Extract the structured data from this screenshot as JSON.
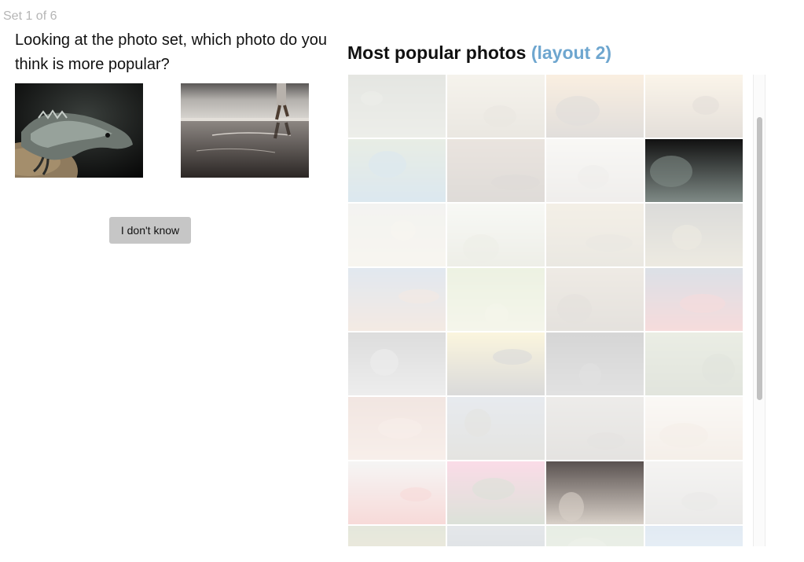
{
  "progress": {
    "label": "Set 1 of 6"
  },
  "question": {
    "text": "Looking at the photo set, which photo do you think is more popular?"
  },
  "choices": [
    {
      "subject": "iguana-photo"
    },
    {
      "subject": "beach-walker-photo"
    }
  ],
  "dont_know": {
    "label": "I don't know"
  },
  "gallery": {
    "title": "Most popular photos",
    "title_suffix": "(layout 2)",
    "tiles": [
      {
        "subject": "palm-frond",
        "c1": "#6e7560",
        "c2": "#9aa088",
        "highlight": false
      },
      {
        "subject": "shorebird",
        "c1": "#c9bb98",
        "c2": "#8c7c5c",
        "highlight": false
      },
      {
        "subject": "beach-hut-sunset",
        "c1": "#e0a458",
        "c2": "#5a4a3a",
        "highlight": false
      },
      {
        "subject": "moose-in-mist",
        "c1": "#e6c48a",
        "c2": "#6a4e30",
        "highlight": false
      },
      {
        "subject": "kingfisher",
        "c1": "#7f9a6c",
        "c2": "#3c7ea8",
        "highlight": false
      },
      {
        "subject": "donkeys",
        "c1": "#8a6a4c",
        "c2": "#4c3a28",
        "highlight": false
      },
      {
        "subject": "white-horse",
        "c1": "#d9d4c8",
        "c2": "#a8a094",
        "highlight": false
      },
      {
        "subject": "iguana",
        "c1": "#111111",
        "c2": "#7f8a86",
        "highlight": true
      },
      {
        "subject": "misty-horizon",
        "c1": "#bcbcb0",
        "c2": "#d4c8a8",
        "highlight": false
      },
      {
        "subject": "framed-field",
        "c1": "#d6d8c8",
        "c2": "#9ea27c",
        "highlight": false
      },
      {
        "subject": "dry-plain",
        "c1": "#c0a878",
        "c2": "#8c8060",
        "highlight": false
      },
      {
        "subject": "old-clock",
        "c1": "#3a3a32",
        "c2": "#9a8a5a",
        "highlight": false
      },
      {
        "subject": "cloudy-coast",
        "c1": "#5c7fa8",
        "c2": "#c08a64",
        "highlight": false
      },
      {
        "subject": "green-sprout",
        "c1": "#9ab460",
        "c2": "#c4c890",
        "highlight": false
      },
      {
        "subject": "stone-ruin",
        "c1": "#a48c6c",
        "c2": "#6c5c44",
        "highlight": false
      },
      {
        "subject": "red-kite-sky",
        "c1": "#3c5478",
        "c2": "#cc3c3c",
        "highlight": false
      },
      {
        "subject": "mono-portrait",
        "c1": "#444444",
        "c2": "#9c9c9c",
        "highlight": false
      },
      {
        "subject": "yellow-insect",
        "c1": "#e6c848",
        "c2": "#343434",
        "highlight": false
      },
      {
        "subject": "dark-face",
        "c1": "#1c1c1c",
        "c2": "#5c5c5c",
        "highlight": false
      },
      {
        "subject": "green-grove",
        "c1": "#8c9c6c",
        "c2": "#5c6c44",
        "highlight": false
      },
      {
        "subject": "red-fort",
        "c1": "#b4745c",
        "c2": "#d4a48c",
        "highlight": false
      },
      {
        "subject": "city-dome",
        "c1": "#7c8ca4",
        "c2": "#6c6a58",
        "highlight": false
      },
      {
        "subject": "old-man-tree",
        "c1": "#9c9488",
        "c2": "#6c6458",
        "highlight": false
      },
      {
        "subject": "milk-glass",
        "c1": "#e4d8c8",
        "c2": "#c4a484",
        "highlight": false
      },
      {
        "subject": "flamingo",
        "c1": "#c8c8c4",
        "c2": "#d4342c",
        "highlight": false
      },
      {
        "subject": "pink-flower",
        "c1": "#e43c7c",
        "c2": "#3c5c2c",
        "highlight": false
      },
      {
        "subject": "beach-walker",
        "c1": "#5a5250",
        "c2": "#d8d0c8",
        "highlight": true
      },
      {
        "subject": "sandy-ground",
        "c1": "#c4c0b8",
        "c2": "#8c8880",
        "highlight": false
      },
      {
        "subject": "bee-flower",
        "c1": "#6c7c3c",
        "c2": "#c48c3c",
        "highlight": false
      },
      {
        "subject": "toucan",
        "c1": "#6c7c8c",
        "c2": "#2c3c4c",
        "highlight": false
      },
      {
        "subject": "green-hill",
        "c1": "#7c9c6c",
        "c2": "#a4b48c",
        "highlight": false
      },
      {
        "subject": "blue-sky",
        "c1": "#5c8cbc",
        "c2": "#a4c4dc",
        "highlight": false
      }
    ]
  }
}
